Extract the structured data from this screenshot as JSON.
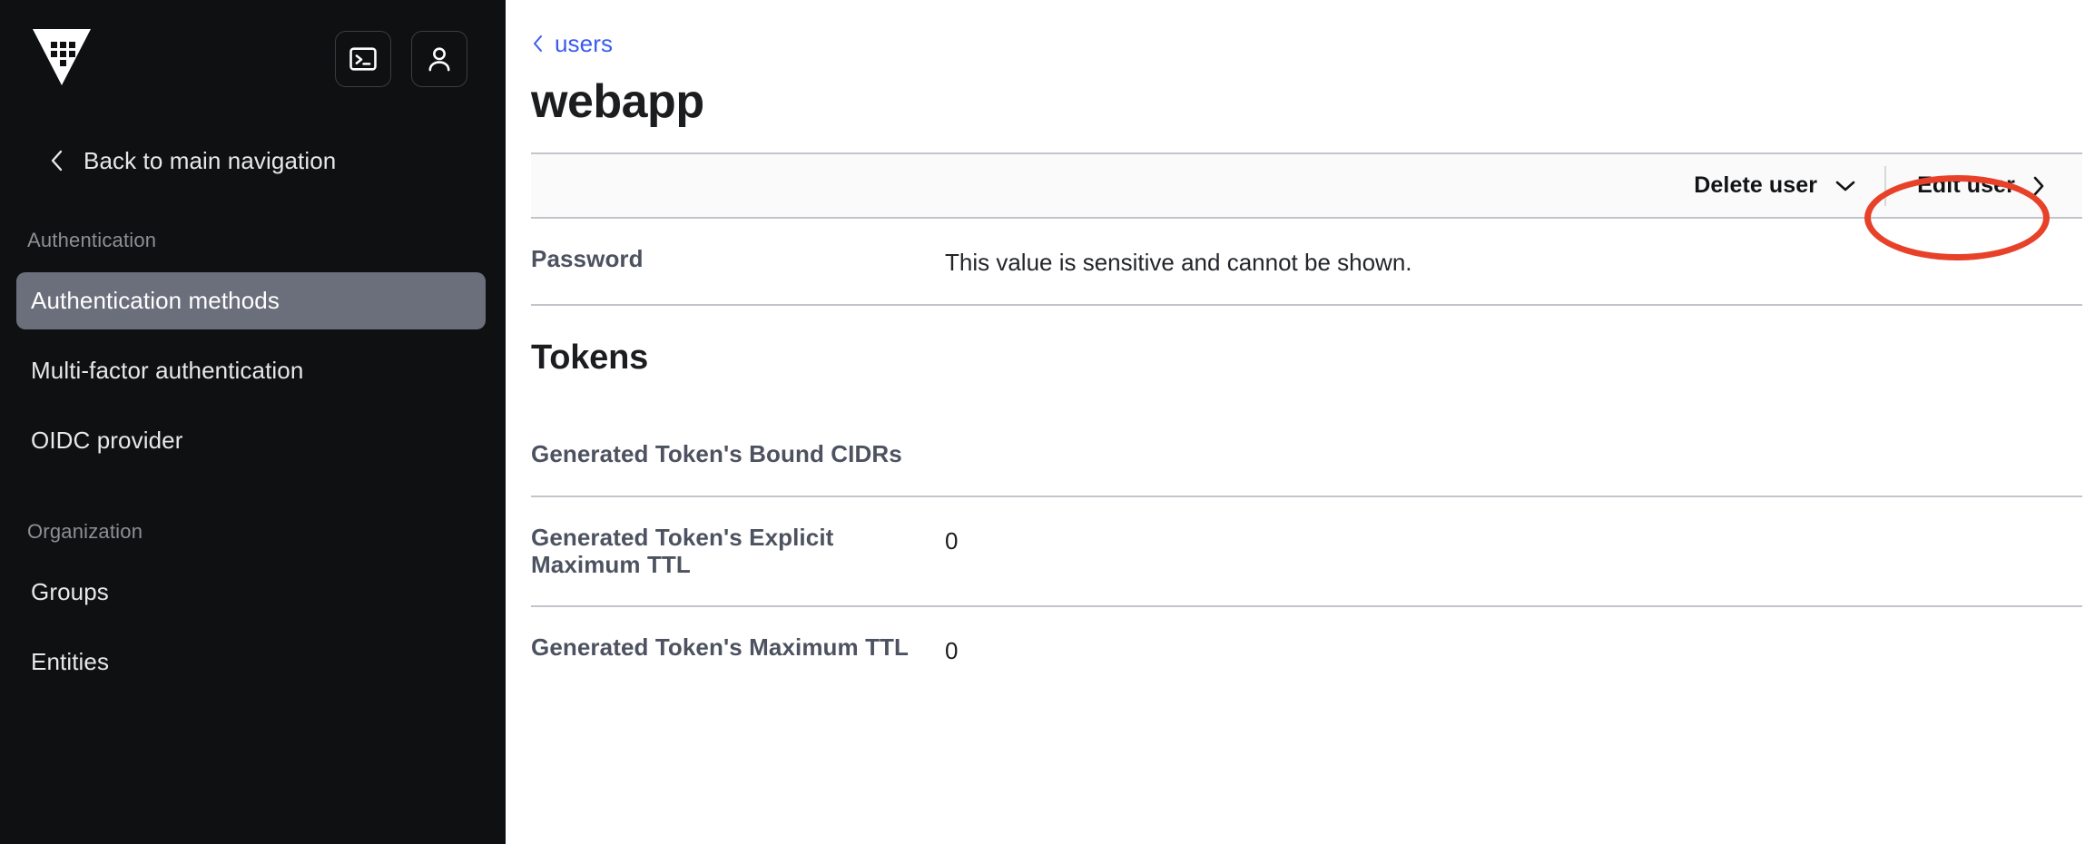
{
  "sidebar": {
    "logo_name": "vault-logo",
    "top_actions": [
      {
        "name": "console-toggle-button",
        "icon": "terminal-icon",
        "label": "Console"
      },
      {
        "name": "user-menu-button",
        "icon": "user-icon",
        "label": "User menu"
      }
    ],
    "back_nav": {
      "label": "Back to main navigation",
      "icon": "chevron-left-icon"
    },
    "sections": [
      {
        "title": "Authentication",
        "items": [
          {
            "label": "Authentication methods",
            "active": true
          },
          {
            "label": "Multi-factor authentication",
            "active": false
          },
          {
            "label": "OIDC provider",
            "active": false
          }
        ]
      },
      {
        "title": "Organization",
        "items": [
          {
            "label": "Groups",
            "active": false
          },
          {
            "label": "Entities",
            "active": false
          }
        ]
      }
    ],
    "active_item_color": "#6b6f7c",
    "background_color": "#0f1011"
  },
  "main": {
    "breadcrumb": {
      "chevron": "‹",
      "link": "users"
    },
    "page_title": "webapp",
    "toolbar": {
      "delete_user_label": "Delete user",
      "delete_user_icon": "chevron-down-icon",
      "edit_user_label": "Edit user",
      "edit_user_icon": "chevron-right-icon"
    },
    "password_row": {
      "label": "Password",
      "value": "This value is sensitive and cannot be shown."
    },
    "tokens_heading": "Tokens",
    "token_rows": [
      {
        "label": "Generated Token's Bound CIDRs",
        "value": ""
      },
      {
        "label": "Generated Token's Explicit Maximum TTL",
        "value": "0"
      },
      {
        "label": "Generated Token's Maximum TTL",
        "value": "0"
      }
    ]
  },
  "annotation": {
    "shape": "ellipse",
    "color": "#e8412a",
    "target": "Edit user"
  },
  "colors": {
    "link": "#3b5bf0",
    "annotation": "#e8412a",
    "sidebar_bg": "#0f1011",
    "toolbar_bg": "#fafafa",
    "divider": "#c2c5cb"
  }
}
